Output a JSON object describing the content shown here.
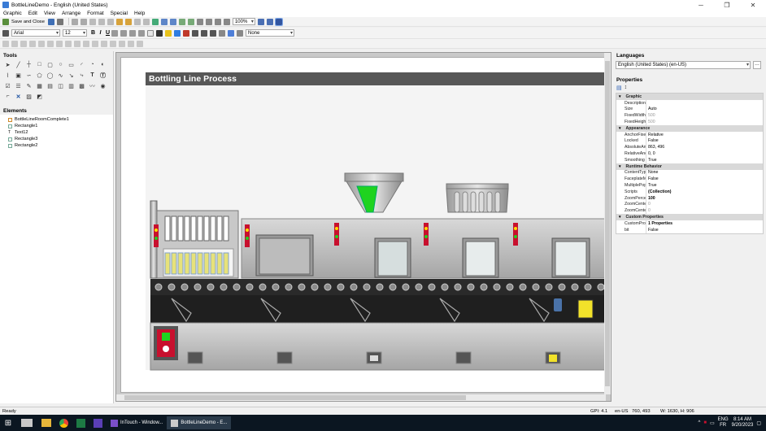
{
  "window": {
    "title": "BottleLineDemo - English (United States)"
  },
  "menu": [
    "Graphic",
    "Edit",
    "View",
    "Arrange",
    "Format",
    "Special",
    "Help"
  ],
  "toolbar": {
    "save_close": "Save and Close",
    "zoom": "100%",
    "font": "Arial",
    "size": "12",
    "bold": "B",
    "italic": "I",
    "underline": "U",
    "fill_style": "None"
  },
  "panels": {
    "tools": "Tools",
    "elements": "Elements",
    "languages": "Languages",
    "properties": "Properties"
  },
  "elements": [
    {
      "name": "BottleLineRoomComplete1",
      "icon": "group-icon"
    },
    {
      "name": "Rectangle1",
      "icon": "rectangle-icon"
    },
    {
      "name": "Text12",
      "icon": "text-icon"
    },
    {
      "name": "Rectangle3",
      "icon": "rectangle-icon"
    },
    {
      "name": "Rectangle2",
      "icon": "rectangle-icon"
    }
  ],
  "language": "English (United States) (en-US)",
  "canvas": {
    "title": "Bottling Line Process"
  },
  "properties": [
    {
      "cat": "Graphic"
    },
    {
      "k": "Description",
      "v": ""
    },
    {
      "k": "Size",
      "v": "Auto"
    },
    {
      "k": "FixedWidth",
      "v": "500",
      "dim": true
    },
    {
      "k": "FixedHeight",
      "v": "500",
      "dim": true
    },
    {
      "cat": "Appearance"
    },
    {
      "k": "AnchorFixedT",
      "v": "Relative"
    },
    {
      "k": "Locked",
      "v": "False"
    },
    {
      "k": "AbsoluteAnc",
      "v": "863, 496"
    },
    {
      "k": "RelativeAnch",
      "v": "0, 0"
    },
    {
      "k": "Smoothing",
      "v": "True"
    },
    {
      "cat": "Runtime Behavior"
    },
    {
      "k": "ContentType",
      "v": "None"
    },
    {
      "k": "FaceplateMo",
      "v": "False"
    },
    {
      "k": "MultiplePops",
      "v": "True"
    },
    {
      "k": "Scripts",
      "v": "(Collection)",
      "bold": true
    },
    {
      "k": "ZoomPercent",
      "v": "100",
      "bold": true
    },
    {
      "k": "ZoomCenterX",
      "v": "0",
      "dim": true
    },
    {
      "k": "ZoomCenterY",
      "v": "0",
      "dim": true
    },
    {
      "cat": "Custom Properties"
    },
    {
      "k": "CustomPrope",
      "v": "1 Properties",
      "bold": true
    },
    {
      "k": "bit",
      "v": "False"
    }
  ],
  "status": {
    "text": "Ready",
    "gpi": "GPI: 4.1",
    "lang": "en-US",
    "coords": "760, 493",
    "size": "W: 1630, H: 906"
  },
  "taskbar": {
    "apps": [
      "InTouch - Window...",
      "BottleLineDemo - E..."
    ],
    "lang1": "ENG",
    "lang2": "FR",
    "time": "8:14 AM",
    "date": "9/20/2023"
  },
  "colors": {
    "header": "#575757",
    "green": "#1fd31f",
    "red": "#c8102e"
  }
}
